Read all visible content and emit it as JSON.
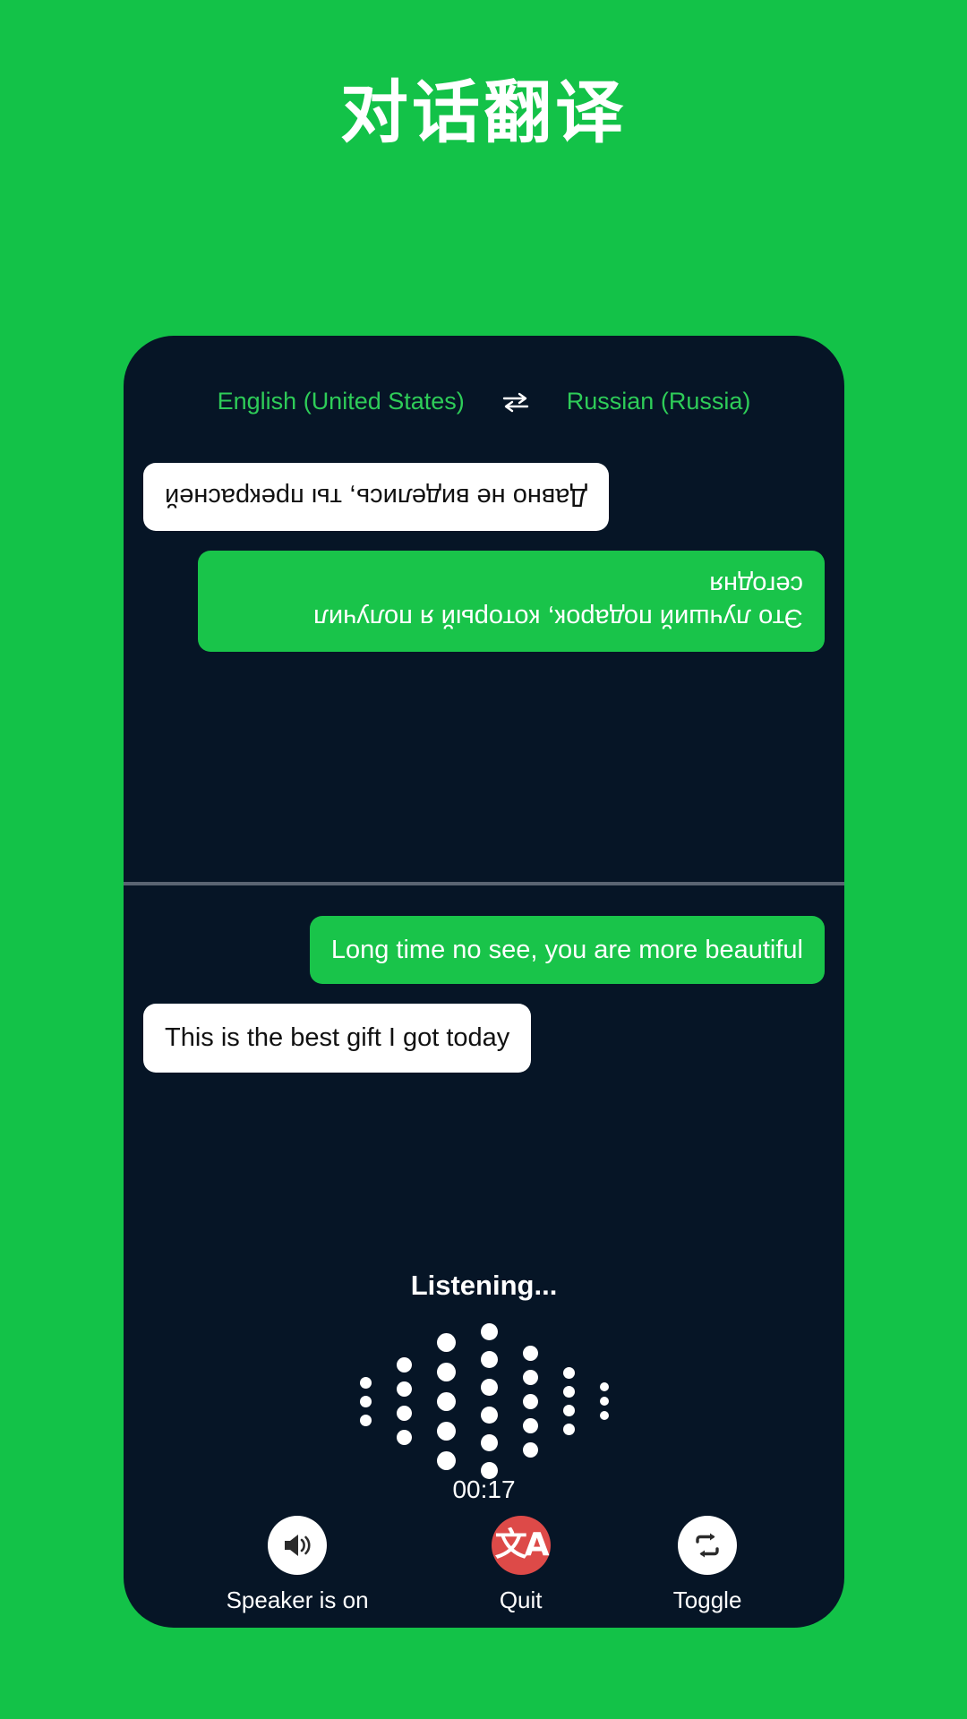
{
  "page": {
    "title": "对话翻译",
    "background_color": "#13c248"
  },
  "phone": {
    "background_color": "#061526",
    "accent_green": "#19c44a",
    "quit_red": "#dd4a48"
  },
  "language_bar": {
    "source_language": "English (United States)",
    "swap_icon": "swap-horizontal-icon",
    "target_language": "Russian (Russia)"
  },
  "conversation": {
    "top_panel_rotated": true,
    "top_messages": [
      {
        "text": "Это лучший подарок, который я получил сегодня",
        "style": "green",
        "align": "left"
      },
      {
        "text": "Давно не виделись, ты прекрасней",
        "style": "white",
        "align": "right"
      }
    ],
    "bottom_messages": [
      {
        "text": "Long time no see, you are more beautiful",
        "style": "green",
        "align": "right"
      },
      {
        "text": "This is the best gift I got today",
        "style": "white",
        "align": "left"
      }
    ]
  },
  "status": {
    "listening_label": "Listening...",
    "timer": "00:17"
  },
  "waveform": {
    "columns": [
      {
        "dots": 3,
        "size": 13
      },
      {
        "dots": 4,
        "size": 17
      },
      {
        "dots": 5,
        "size": 21
      },
      {
        "dots": 6,
        "size": 19
      },
      {
        "dots": 5,
        "size": 17
      },
      {
        "dots": 4,
        "size": 13
      },
      {
        "dots": 3,
        "size": 10
      }
    ]
  },
  "controls": [
    {
      "id": "speaker",
      "label": "Speaker is on",
      "icon": "speaker-on-icon",
      "circle": "white"
    },
    {
      "id": "quit",
      "label": "Quit",
      "icon": "translate-icon",
      "glyph": "文A",
      "circle": "red"
    },
    {
      "id": "toggle",
      "label": "Toggle",
      "icon": "repeat-swap-icon",
      "circle": "white"
    }
  ]
}
